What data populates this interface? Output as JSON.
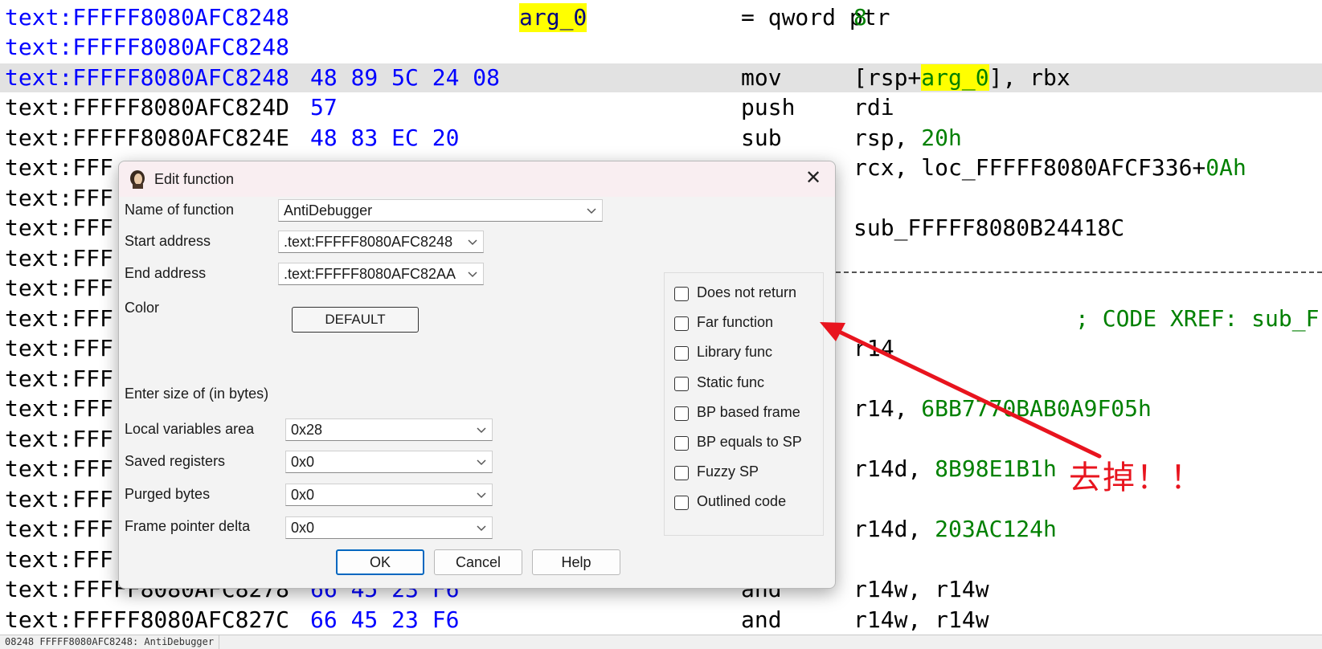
{
  "disassembly": {
    "lines": [
      {
        "addr": "text:FFFFF8080AFC8248",
        "addr_blue": true,
        "bytes": "",
        "mnemonic": "",
        "operands": ""
      },
      {
        "addr": "text:FFFFF8080AFC8248",
        "addr_blue": true,
        "bytes": "",
        "arg_name": "arg_0",
        "mnemonic": "= qword ptr",
        "operand_num": "8"
      },
      {
        "addr": "text:FFFFF8080AFC8248",
        "addr_blue": true,
        "bytes": "",
        "mnemonic": "",
        "operands": ""
      },
      {
        "addr": "text:FFFFF8080AFC8248",
        "addr_blue": true,
        "bytes": "48 89 5C 24 08",
        "mnemonic": "mov",
        "op_pre": "[rsp+",
        "op_hl": "arg_0",
        "op_post": "], rbx",
        "highlighted": true
      },
      {
        "addr": "text:FFFFF8080AFC824D",
        "bytes": "57",
        "mnemonic": "push",
        "operands": "rdi"
      },
      {
        "addr": "text:FFFFF8080AFC824E",
        "bytes": "48 83 EC 20",
        "mnemonic": "sub",
        "op_pre": "rsp, ",
        "op_num": "20h"
      },
      {
        "addr": "text:FFF",
        "bytes": "",
        "mnemonic": "",
        "op_pre": "rcx, loc_FFFFF8080AFCF336+",
        "op_num": "0Ah"
      },
      {
        "addr": "text:FFF",
        "bytes": "",
        "mnemonic": "",
        "operands": ""
      },
      {
        "addr": "text:FFF",
        "bytes": "",
        "mnemonic": "",
        "operands": "sub_FFFFF8080B24418C"
      },
      {
        "addr": "text:FFF",
        "bytes": "",
        "mnemonic": "",
        "operands": ""
      },
      {
        "addr": "text:FFF",
        "bytes": "",
        "mnemonic": "",
        "operands": ""
      },
      {
        "addr": "text:FFF",
        "bytes": "",
        "mnemonic": "",
        "operands": "",
        "comment": "; CODE XREF: sub_F"
      },
      {
        "addr": "text:FFF",
        "bytes": "",
        "mnemonic": "",
        "operands": "r14"
      },
      {
        "addr": "text:FFF",
        "bytes": "",
        "mnemonic": "",
        "operands": ""
      },
      {
        "addr": "text:FFF",
        "bytes": "",
        "mnemonic": "",
        "op_pre": "r14, ",
        "op_num": "6BB7770BAB0A9F05h"
      },
      {
        "addr": "text:FFF",
        "bytes": "",
        "mnemonic": "",
        "operands": ""
      },
      {
        "addr": "text:FFF",
        "bytes": "",
        "mnemonic": "",
        "op_pre": "r14d, ",
        "op_num": "8B98E1B1h"
      },
      {
        "addr": "text:FFF",
        "bytes": "",
        "mnemonic": "",
        "operands": ""
      },
      {
        "addr": "text:FFF",
        "bytes": "",
        "mnemonic": "",
        "op_pre": "r14d, ",
        "op_num": "203AC124h"
      },
      {
        "addr": "text:FFF",
        "bytes": "",
        "mnemonic": "",
        "operands": ""
      },
      {
        "addr": "text:FFFFF8080AFC8278",
        "bytes": "66 45 23 F6",
        "mnemonic": "and",
        "operands": "r14w, r14w"
      },
      {
        "addr": "text:FFFFF8080AFC827C",
        "bytes": "66 45 23 F6",
        "mnemonic": "and",
        "operands": "r14w, r14w"
      }
    ]
  },
  "status_bar": {
    "text": "08248 FFFFF8080AFC8248: AntiDebugger"
  },
  "dialog": {
    "title": "Edit function",
    "close_glyph": "✕",
    "fields": {
      "name_label": "Name of function",
      "name_value": "AntiDebugger",
      "start_label": "Start address",
      "start_value": ".text:FFFFF8080AFC8248",
      "end_label": "End address",
      "end_value": ".text:FFFFF8080AFC82AA",
      "color_label": "Color",
      "color_button": "DEFAULT",
      "size_heading": "Enter size of (in bytes)",
      "local_label": "Local variables area",
      "local_value": "0x28",
      "saved_label": "Saved registers",
      "saved_value": "0x0",
      "purged_label": "Purged bytes",
      "purged_value": "0x0",
      "fpd_label": "Frame pointer delta",
      "fpd_value": "0x0"
    },
    "checkboxes": [
      {
        "label": "Does not return",
        "checked": false
      },
      {
        "label": "Far function",
        "checked": false
      },
      {
        "label": "Library func",
        "checked": false
      },
      {
        "label": "Static func",
        "checked": false
      },
      {
        "label": "BP based frame",
        "checked": false
      },
      {
        "label": "BP equals to SP",
        "checked": false
      },
      {
        "label": "Fuzzy SP",
        "checked": false
      },
      {
        "label": "Outlined code",
        "checked": false
      }
    ],
    "buttons": {
      "ok": "OK",
      "cancel": "Cancel",
      "help": "Help"
    }
  },
  "annotation": {
    "text": "去掉！！",
    "color": "#e8141e"
  },
  "colors": {
    "address_blue": "#0000ff",
    "number_green": "#008000",
    "highlight_yellow": "#ffff00",
    "accent": "#0067c0"
  }
}
